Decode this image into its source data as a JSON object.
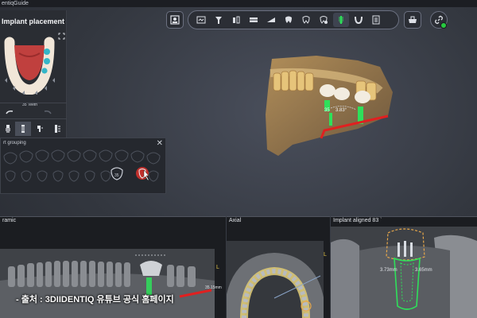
{
  "window": {
    "title": "entiqGuide"
  },
  "toolbar": {
    "single_left_icon": "patient-icon",
    "group_icons": [
      "panoramic-icon",
      "implant-icon",
      "crown-icon",
      "arch-icon",
      "scan-icon",
      "tooth-icon",
      "tooth-outline-icon",
      "tooth-settings-icon",
      "implant-screw-icon",
      "arch-curve-icon",
      "report-icon"
    ],
    "right_icon": "sleeve-icon",
    "link_icon": "link-icon",
    "status_color": "#27c93f"
  },
  "left_panel": {
    "title": "Implant placement",
    "teeth_count": "35 Teeth"
  },
  "grouping": {
    "title": "rt grouping",
    "close": "✕"
  },
  "viewport": {
    "measure_label": "3.83°",
    "implant_label": "35"
  },
  "panes": {
    "panoramic": {
      "title": "ramic",
      "scale": "35.15mm",
      "corner": "L"
    },
    "axial": {
      "title": "Axial",
      "corner": "L"
    },
    "aligned": {
      "title": "Implant aligned 83 `",
      "left_measure": "3.73mm",
      "right_measure": "3.65mm"
    }
  },
  "caption": "- 출처 : 3DIIDENTIQ 유튜브 공식 홈페이지"
}
